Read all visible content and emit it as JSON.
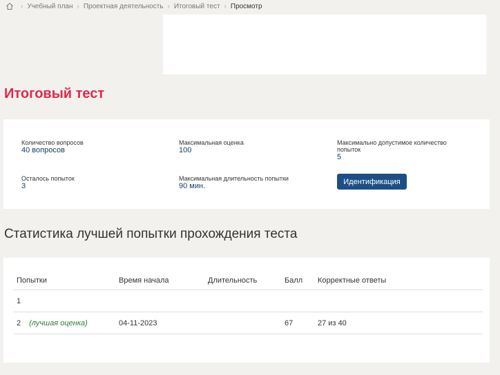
{
  "breadcrumb": {
    "home_icon": "home-icon",
    "items": [
      "Учебный план",
      "Проектная деятельность",
      "Итоговый тест",
      "Просмотр"
    ]
  },
  "page": {
    "title": "Итоговый тест"
  },
  "info": {
    "questions_label": "Количество вопросов",
    "questions_value": "40 вопросов",
    "max_score_label": "Максимальная оценка",
    "max_score_value": "100",
    "max_attempts_label": "Максимально допустимое количество попыток",
    "max_attempts_value": "5",
    "attempts_left_label": "Осталось попыток",
    "attempts_left_value": "3",
    "max_duration_label": "Максимальная длительность попытки",
    "max_duration_value": "90 мин.",
    "ident_button": "Идентификация"
  },
  "stats": {
    "title": "Статистика лучшей попытки прохождения теста",
    "columns": [
      "Попытки",
      "Время начала",
      "Длительность",
      "Балл",
      "Корректные ответы"
    ],
    "rows": [
      {
        "attempt": "1",
        "note": "",
        "start": "",
        "duration": "",
        "score": "",
        "correct": ""
      },
      {
        "attempt": "2",
        "note": "(лучшая оценка)",
        "start": "04-11-2023",
        "duration": "",
        "score": "67",
        "correct": "27 из 40"
      }
    ]
  },
  "colors": {
    "title": "#e3284b",
    "button": "#1d4f86",
    "best_note": "#2e7d32",
    "value": "#1a3a6b"
  }
}
